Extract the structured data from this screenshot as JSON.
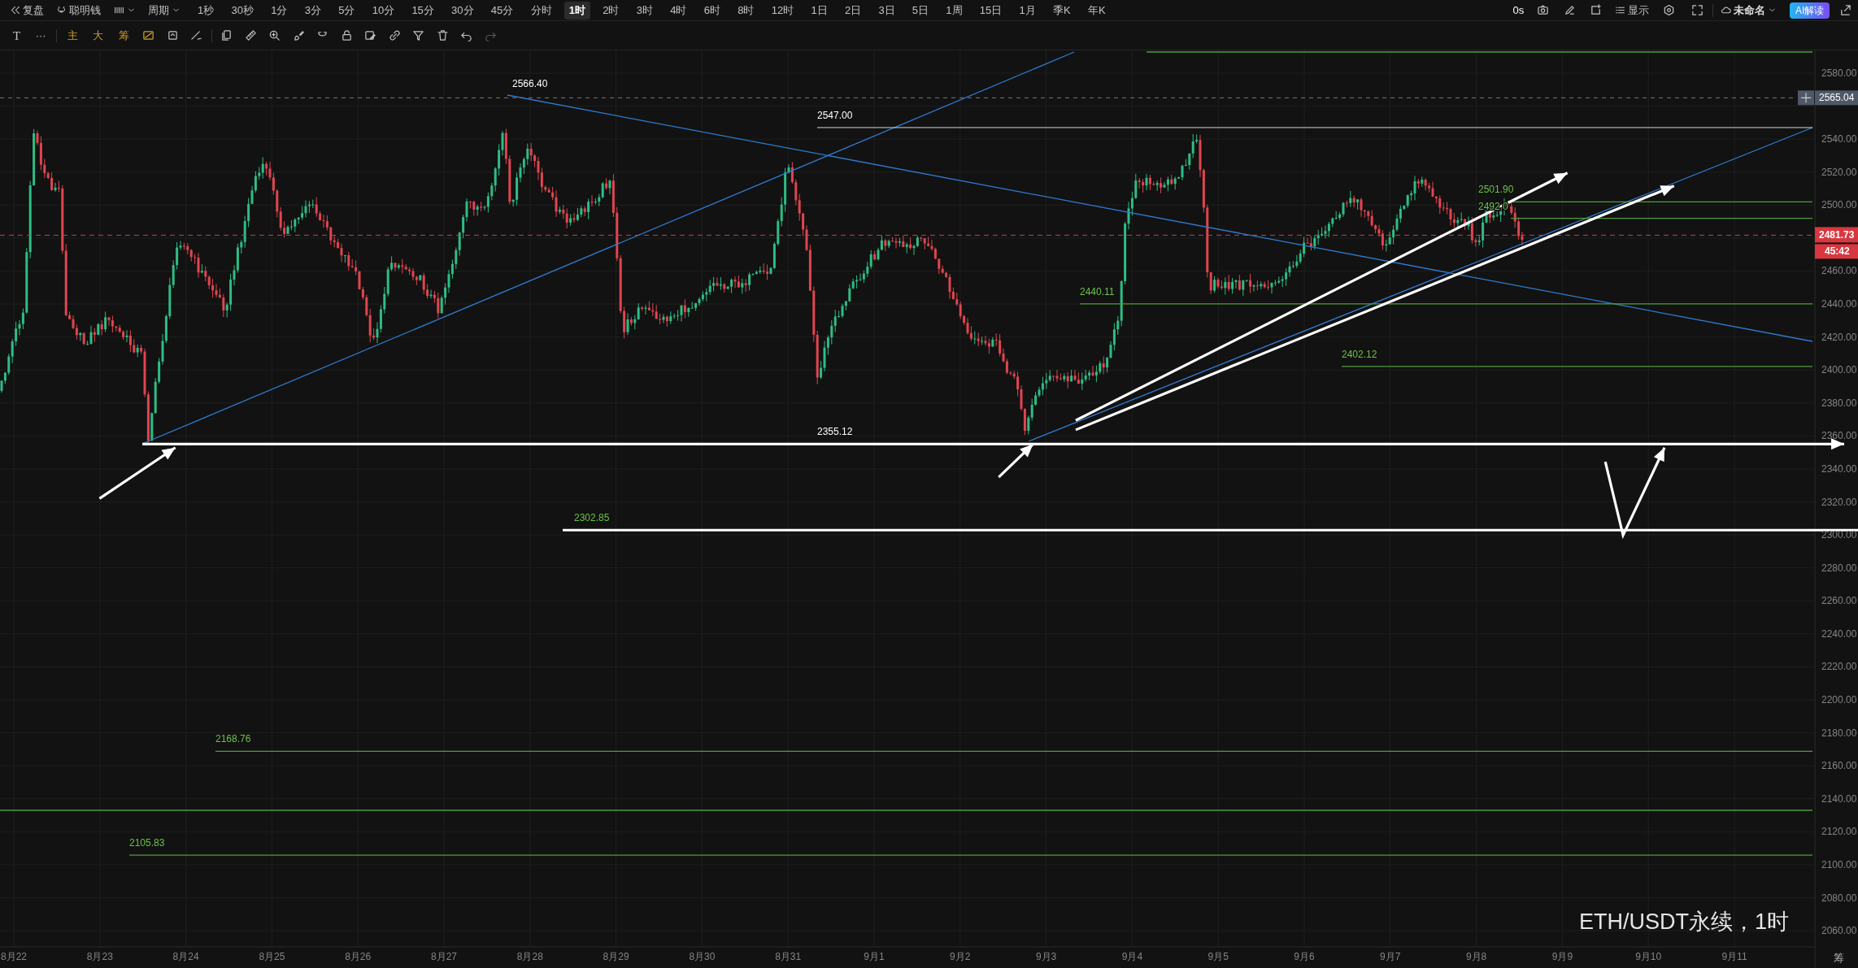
{
  "toolbar": {
    "replay": "复盘",
    "smart_money": "聪明钱",
    "period": "周期",
    "intervals": [
      {
        "label": "1秒",
        "selected": false
      },
      {
        "label": "30秒",
        "selected": false
      },
      {
        "label": "1分",
        "selected": false
      },
      {
        "label": "3分",
        "selected": false
      },
      {
        "label": "5分",
        "selected": false
      },
      {
        "label": "10分",
        "selected": false
      },
      {
        "label": "15分",
        "selected": false
      },
      {
        "label": "30分",
        "selected": false
      },
      {
        "label": "45分",
        "selected": false
      },
      {
        "label": "分时",
        "selected": false
      },
      {
        "label": "1时",
        "selected": true
      },
      {
        "label": "2时",
        "selected": false
      },
      {
        "label": "3时",
        "selected": false
      },
      {
        "label": "4时",
        "selected": false
      },
      {
        "label": "6时",
        "selected": false
      },
      {
        "label": "8时",
        "selected": false
      },
      {
        "label": "12时",
        "selected": false
      },
      {
        "label": "1日",
        "selected": false
      },
      {
        "label": "2日",
        "selected": false
      },
      {
        "label": "3日",
        "selected": false
      },
      {
        "label": "5日",
        "selected": false
      },
      {
        "label": "1周",
        "selected": false
      },
      {
        "label": "15日",
        "selected": false
      },
      {
        "label": "1月",
        "selected": false
      },
      {
        "label": "季K",
        "selected": false
      },
      {
        "label": "年K",
        "selected": false
      }
    ],
    "timer": "0s",
    "display": "显示",
    "layout_name": "未命名",
    "ai_button": "AI解读"
  },
  "drawing_toolbar": {
    "text_tool": "T",
    "more": "···",
    "overlays": [
      "主",
      "大",
      "筹"
    ]
  },
  "chart": {
    "price_axis": [
      "2580.00",
      "2540.00",
      "2520.00",
      "2500.00",
      "2460.00",
      "2440.00",
      "2420.00",
      "2400.00",
      "2380.00",
      "2360.00",
      "2340.00",
      "2320.00",
      "2300.00",
      "2280.00",
      "2260.00",
      "2240.00",
      "2220.00",
      "2200.00",
      "2180.00",
      "2160.00",
      "2140.00",
      "2120.00",
      "2100.00",
      "2080.00",
      "2060.00"
    ],
    "date_axis": [
      "8月22",
      "8月23",
      "8月24",
      "8月25",
      "8月26",
      "8月27",
      "8月28",
      "8月29",
      "8月30",
      "8月31",
      "9月1",
      "9月2",
      "9月3",
      "9月4",
      "9月5",
      "9月6",
      "9月7",
      "9月8",
      "9月9",
      "9月10",
      "9月11"
    ],
    "crosshair_price": "2565.04",
    "last_price": "2481.73",
    "countdown": "45:42",
    "levels": [
      {
        "label": "2566.40",
        "color": "#ffffff"
      },
      {
        "label": "2547.00",
        "color": "#ffffff"
      },
      {
        "label": "2501.90",
        "color": "#6cc24a"
      },
      {
        "label": "2492.0",
        "color": "#6cc24a"
      },
      {
        "label": "2440.11",
        "color": "#6cc24a"
      },
      {
        "label": "2402.12",
        "color": "#6cc24a"
      },
      {
        "label": "2355.12",
        "color": "#ffffff"
      },
      {
        "label": "2302.85",
        "color": "#6cc24a"
      },
      {
        "label": "2168.76",
        "color": "#6cc24a"
      },
      {
        "label": "2105.83",
        "color": "#6cc24a"
      }
    ],
    "legend": "ETH/USDT永续，1时",
    "corner_label": "筹"
  }
}
